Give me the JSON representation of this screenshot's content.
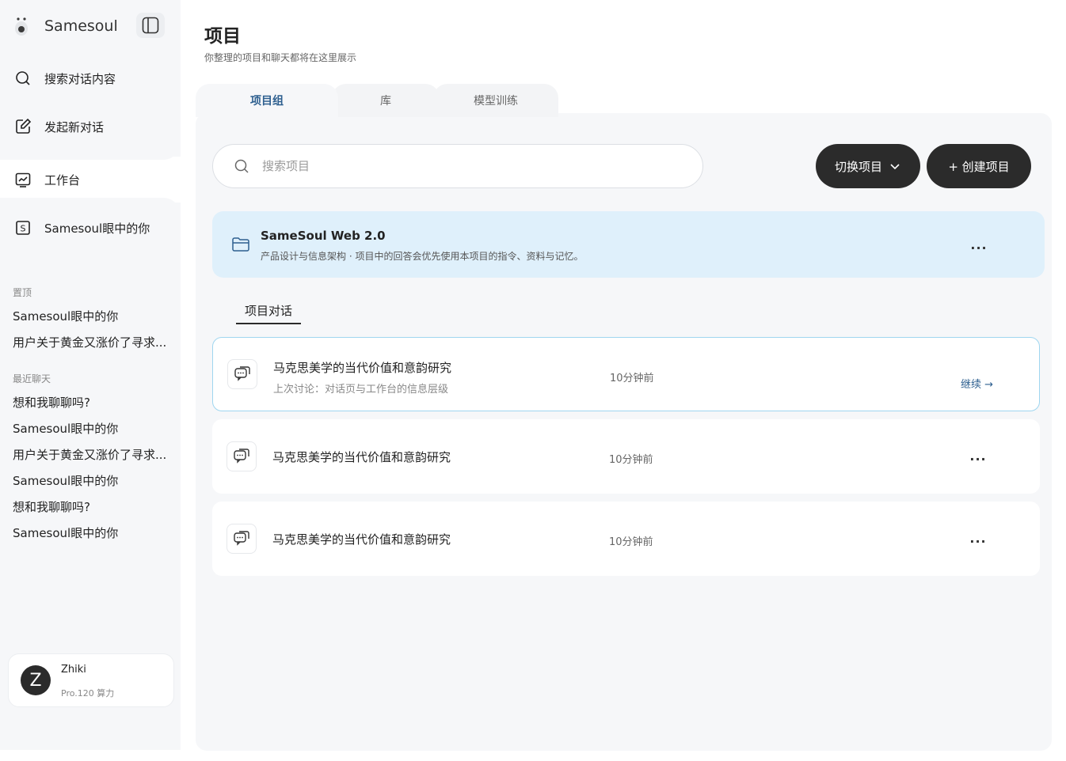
{
  "app": {
    "name": "Samesoul"
  },
  "sidebar": {
    "nav": [
      {
        "label": "搜索对话内容",
        "icon": "search-icon"
      },
      {
        "label": "发起新对话",
        "icon": "edit-icon"
      },
      {
        "label": "工作台",
        "icon": "chart-icon"
      },
      {
        "label": "Samesoul眼中的你",
        "icon": "s-badge-icon"
      }
    ],
    "pinned_label": "置顶",
    "pinned": [
      "Samesoul眼中的你",
      "用户关于黄金又涨价了寻求..."
    ],
    "recent_label": "最近聊天",
    "recent": [
      "想和我聊聊吗?",
      "Samesoul眼中的你",
      "用户关于黄金又涨价了寻求...",
      "Samesoul眼中的你",
      "想和我聊聊吗?",
      "Samesoul眼中的你"
    ],
    "user": {
      "initial": "Z",
      "name": "Zhiki",
      "plan": "Pro.120 算力"
    }
  },
  "main": {
    "title": "项目",
    "subtitle": "你整理的项目和聊天都将在这里展示",
    "tabs": [
      "项目组",
      "库",
      "模型训练"
    ],
    "search": {
      "placeholder": "搜索项目"
    },
    "switch_label": "切换项目",
    "create_label": "+ 创建项目",
    "project": {
      "name": "SameSoul Web 2.0",
      "desc": "产品设计与信息架构 · 项目中的回答会优先使用本项目的指令、资料与记忆。",
      "more": "..."
    },
    "conv_section_label": "项目对话",
    "conversations": [
      {
        "title": "马克思美学的当代价值和意韵研究",
        "sub": "上次讨论：对话页与工作台的信息层级",
        "time": "10分钟前",
        "action": "继续 →"
      },
      {
        "title": "马克思美学的当代价值和意韵研究",
        "time": "10分钟前",
        "more": "..."
      },
      {
        "title": "马克思美学的当代价值和意韵研究",
        "time": "10分钟前",
        "more": "..."
      }
    ]
  },
  "colors": {
    "accent": "#2d5f8f",
    "dark_button": "#2b2b2b",
    "project_bg": "#dff0fb",
    "active_border": "#9fd6f0"
  }
}
